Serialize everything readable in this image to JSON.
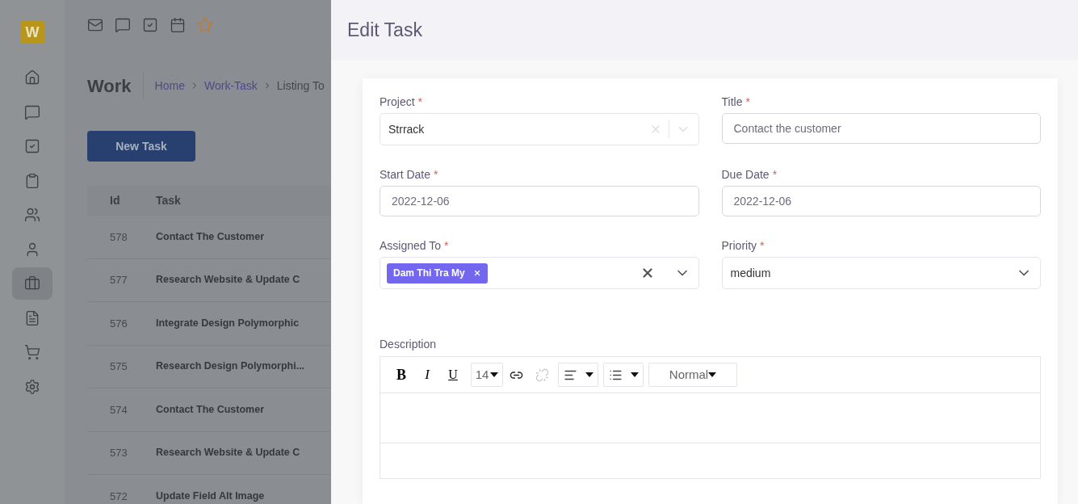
{
  "logo": "W",
  "sidebar": {
    "items": [
      {
        "selected": false
      },
      {
        "selected": false
      },
      {
        "selected": false
      },
      {
        "selected": false
      },
      {
        "selected": false
      },
      {
        "selected": false
      },
      {
        "selected": true
      },
      {
        "selected": false
      },
      {
        "selected": false
      },
      {
        "selected": false
      }
    ]
  },
  "page": {
    "title": "Work",
    "breadcrumb": [
      {
        "label": "Home",
        "link": true
      },
      {
        "label": "Work-Task",
        "link": true
      },
      {
        "label": "Listing To",
        "link": false
      }
    ],
    "new_button": "New Task"
  },
  "table": {
    "columns": [
      "Id",
      "Task"
    ],
    "rows": [
      {
        "id": "578",
        "task": "Contact The Customer"
      },
      {
        "id": "577",
        "task": "Research Website & Update C"
      },
      {
        "id": "576",
        "task": "Integrate Design Polymorphic"
      },
      {
        "id": "575",
        "task": "Research Design Polymorphi..."
      },
      {
        "id": "574",
        "task": "Contact The Customer"
      },
      {
        "id": "573",
        "task": "Research Website & Update C"
      },
      {
        "id": "572",
        "task": "Update Field Alt Image"
      }
    ]
  },
  "drawer": {
    "title": "Edit Task",
    "fields": [
      {
        "label": "Project",
        "required_mark": "*",
        "kind": "select",
        "value": "Strrack",
        "clearable": true
      },
      {
        "label": "Title",
        "required_mark": "*",
        "kind": "text",
        "value": "Contact the customer"
      },
      {
        "label": "Start Date",
        "required_mark": "*",
        "kind": "text",
        "value": "2022-12-06"
      },
      {
        "label": "Due Date",
        "required_mark": "*",
        "kind": "text",
        "value": "2022-12-06"
      },
      {
        "label": "Assigned To",
        "required_mark": "*",
        "kind": "multi",
        "tags": [
          "Dam Thi Tra My"
        ]
      },
      {
        "label": "Priority",
        "required_mark": "*",
        "kind": "select",
        "value": "medium",
        "clearable": false
      }
    ],
    "description": {
      "label": "Description",
      "tools": [
        {
          "kind": "bold",
          "label": "B"
        },
        {
          "kind": "italic",
          "label": "I"
        },
        {
          "kind": "underline",
          "label": "U"
        },
        {
          "kind": "size",
          "label": "14"
        },
        {
          "kind": "link",
          "disabled": false
        },
        {
          "kind": "unlink",
          "disabled": true
        },
        {
          "kind": "align"
        },
        {
          "kind": "list"
        },
        {
          "kind": "format",
          "label": "Normal"
        }
      ]
    }
  }
}
